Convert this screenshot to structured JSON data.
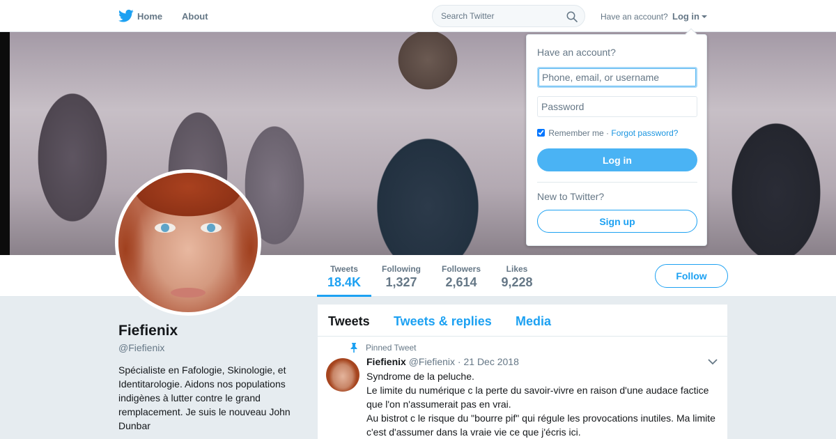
{
  "colors": {
    "accent": "#1da1f2",
    "accent_light": "#4ab3f4",
    "muted": "#657786",
    "page_bg": "#e6ecf0"
  },
  "nav": {
    "logo_icon": "twitter-bird-icon",
    "home_label": "Home",
    "about_label": "About",
    "search_placeholder": "Search Twitter",
    "search_icon": "search-icon",
    "have_account": "Have an account?",
    "login_label": "Log in"
  },
  "profile": {
    "name": "Fiefienix",
    "handle": "@Fiefienix",
    "bio": "Spécialiste en Fafologie, Skinologie, et Identitarologie. Aidons nos populations indigènes à lutter contre le grand remplacement. Je suis le nouveau John Dunbar",
    "follow_label": "Follow"
  },
  "stats": [
    {
      "label": "Tweets",
      "value": "18.4K",
      "active": true
    },
    {
      "label": "Following",
      "value": "1,327",
      "active": false
    },
    {
      "label": "Followers",
      "value": "2,614",
      "active": false
    },
    {
      "label": "Likes",
      "value": "9,228",
      "active": false
    }
  ],
  "timeline": {
    "tabs": [
      {
        "label": "Tweets",
        "active": true
      },
      {
        "label": "Tweets & replies",
        "active": false
      },
      {
        "label": "Media",
        "active": false
      }
    ],
    "pinned_label": "Pinned Tweet",
    "tweet": {
      "name": "Fiefienix",
      "handle": "@Fiefienix",
      "dot": "·",
      "date": "21 Dec 2018",
      "lines": [
        "Syndrome de la peluche.",
        "Le limite du numérique c la perte du savoir-vivre en raison d'une audace factice que l'on n'assumerait pas en vrai.",
        "Au bistrot c le risque du \"bourre pif\" qui régule les provocations inutiles. Ma limite c'est d'assumer dans la vraie vie ce que j'écris ici."
      ]
    }
  },
  "login_dropdown": {
    "title": "Have an account?",
    "username_placeholder": "Phone, email, or username",
    "password_placeholder": "Password",
    "remember_label": "Remember me",
    "separator": "·",
    "forgot_label": "Forgot password?",
    "remember_checked": true,
    "login_button": "Log in",
    "new_label": "New to Twitter?",
    "signup_button": "Sign up"
  }
}
